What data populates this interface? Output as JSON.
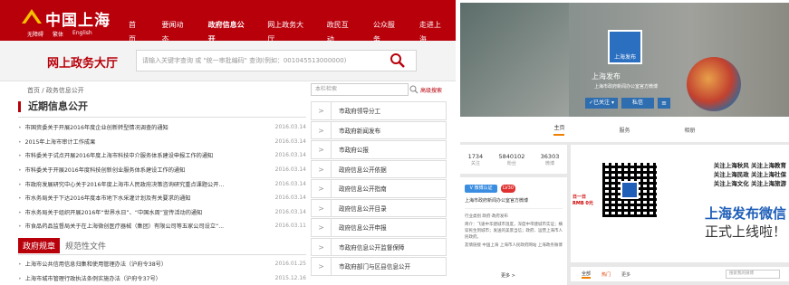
{
  "left": {
    "logo_text": "中国上海",
    "sublinks": [
      "无障碍",
      "繁体",
      "English"
    ],
    "nav": [
      "首页",
      "要闻动态",
      "政府信息公开",
      "网上政务大厅",
      "政民互动",
      "公众服务",
      "走进上海"
    ],
    "nav_active": "政府信息公开",
    "hall_title": "网上政务大厅",
    "search_placeholder": "请输入关键字查询 或 \"统一审批编码\" 查询(例如：001045513000000)",
    "breadcrumb": "首页 / 政务信息公开",
    "side_search_placeholder": "本栏检索",
    "adv_search": "高级搜索",
    "section_title": "近期信息公开",
    "news": [
      {
        "title": "市国资委关于开展2016年度企业创新转型情况调查的通知",
        "date": "2016.03.14"
      },
      {
        "title": "2015年上海市审计工作成果",
        "date": "2016.03.14"
      },
      {
        "title": "市科委关于试点开展2016年度上海市科技中介服务体系建设申报工作的通知",
        "date": "2016.03.14"
      },
      {
        "title": "市科委关于开展2016年度科技创新创业服务体系建设工作的通知",
        "date": "2016.03.14"
      },
      {
        "title": "市政府发展研究中心关于2016年度上海市人民政府决策咨询研究重点课题公开...",
        "date": "2016.03.14"
      },
      {
        "title": "市水务局关于下达2016年度本市地下水采灌计划及有关要求的通知",
        "date": "2016.03.14"
      },
      {
        "title": "市水务局关于组织开展2016年“世界水日”、“中国水周”宣传活动的通知",
        "date": "2016.03.14"
      },
      {
        "title": "市食品药品监督局关于在上海微创医疗器械（集团）有限公司等五家公司设立“...",
        "date": "2016.03.11"
      }
    ],
    "tab_active": "政府规章",
    "tab_other": "规范性文件",
    "rules": [
      {
        "title": "上海市公共信用信息归集和使用管理办法（沪府令38号）",
        "date": "2016.01.25"
      },
      {
        "title": "上海市城市管理行政执法条例实施办法（沪府令37号）",
        "date": "2015.12.16"
      }
    ],
    "menu": [
      "市政府领导分工",
      "市政府新闻发布",
      "市政府公报",
      "政府信息公开依据",
      "政府信息公开指南",
      "政府信息公开目录",
      "政府信息公开申报",
      "市政府信息公开监督保障",
      "市政府部门与区县信息公开"
    ]
  },
  "right": {
    "avatar_text": "上海发布",
    "profile_name": "上海发布",
    "profile_desc": "上海市政府新闻办公室官方微博",
    "btn_follow": "✓已关注 ▾",
    "btn_msg": "私信",
    "btn_more": "≡",
    "tabs": [
      "主页",
      "服务",
      "相册"
    ],
    "stats": [
      {
        "value": "1734",
        "label": "关注"
      },
      {
        "value": "5840102",
        "label": "粉丝"
      },
      {
        "value": "36303",
        "label": "微博"
      }
    ],
    "v_badge": "V 微博认证",
    "v_count": "LV30",
    "v_text": "上海市政府新闻办公室官方微博",
    "v_info": [
      "行业类别 政府·政府发布",
      "简介：飞速中华建城市温度，深度中带建城市实证；横穿民生到城市；发送的美景当信；政府、运营上海市人民政府。",
      "友情链接 中国上海 上海市人民政府网站 上海政务微博"
    ],
    "v_more": "更多 >",
    "poster": {
      "rmb": "日一日\nRMB 0元",
      "lines": "关注上海秋风 关注上海教育\n关注上海民政 关注上海社保\n关注上海文化 关注上海旅游",
      "big1": "上海发布微信",
      "big2": "正式上线啦！"
    },
    "bottom_tabs": [
      "全部",
      "热门",
      "更多"
    ],
    "bottom_search": "搜索我的微博"
  },
  "colors": {
    "brand_red": "#b8000b",
    "weibo_orange": "#f08000",
    "poster_blue": "#1f5fb8"
  }
}
